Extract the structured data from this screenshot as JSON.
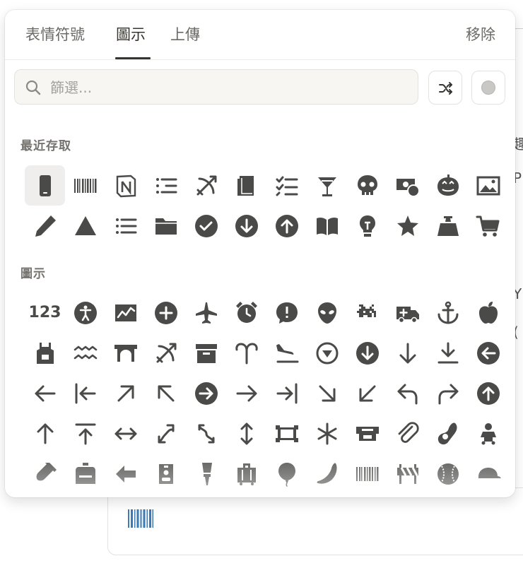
{
  "tabs": [
    "表情符號",
    "圖示",
    "上傳"
  ],
  "active_tab": "圖示",
  "remove_label": "移除",
  "search": {
    "placeholder": "篩選..."
  },
  "sections": {
    "recent": "最近存取",
    "icons": "圖示"
  },
  "icon_color": "#4a4a48",
  "recent_icons": [
    "mobile-phone-icon",
    "barcode-icon",
    "notion-logo-icon",
    "bullet-list-icon",
    "bow-and-arrow-icon",
    "book-icon",
    "checklist-icon",
    "cocktail-glass-icon",
    "skull-icon",
    "money-globe-icon",
    "pumpkin-icon",
    "image-icon",
    "pencil-icon",
    "triangle-icon",
    "list-icon",
    "folder-icon",
    "checkmark-circle-icon",
    "arrow-down-circle-icon",
    "arrow-up-circle-icon",
    "open-book-icon",
    "light-bulb-icon",
    "star-icon",
    "weight-icon",
    "shopping-cart-icon"
  ],
  "icon_list": [
    "123-icon",
    "accessibility-icon",
    "activity-chart-icon",
    "add-circle-icon",
    "airplane-icon",
    "alarm-clock-icon",
    "alert-bubble-icon",
    "alien-icon",
    "space-invader-icon",
    "ambulance-icon",
    "anchor-icon",
    "apple-icon",
    "apron-icon",
    "aquarius-icon",
    "arch-icon",
    "archery-icon",
    "archive-icon",
    "aries-icon",
    "airplane-arrival-icon",
    "arrow-down-triangle-circle-icon",
    "arrow-down-circle-icon",
    "arrow-down-icon",
    "arrow-down-line-icon",
    "arrow-left-circle-icon",
    "arrow-left-icon",
    "arrow-left-line-icon",
    "arrow-up-right-icon",
    "arrow-up-left-icon",
    "arrow-right-circle-icon",
    "arrow-right-icon",
    "arrow-right-line-icon",
    "arrow-down-right-icon",
    "arrow-down-left-icon",
    "arrow-turn-left-icon",
    "arrow-turn-right-icon",
    "arrow-up-circle-icon",
    "arrow-up-icon",
    "arrow-up-line-icon",
    "arrow-left-right-icon",
    "arrow-swap-diagonal-icon",
    "arrow-zigzag-icon",
    "arrow-up-down-icon",
    "picture-frame-icon",
    "asterisk-icon",
    "atm-icon",
    "paperclip-icon",
    "avocado-icon",
    "baby-icon",
    "baby-bottle-icon",
    "backpack-icon",
    "arrow-back-icon",
    "badge-icon",
    "badminton-icon",
    "baggage-icon",
    "balloon-icon",
    "banana-icon",
    "barcode-icon",
    "barrier-icon",
    "baseball-icon",
    "cap-icon"
  ]
}
